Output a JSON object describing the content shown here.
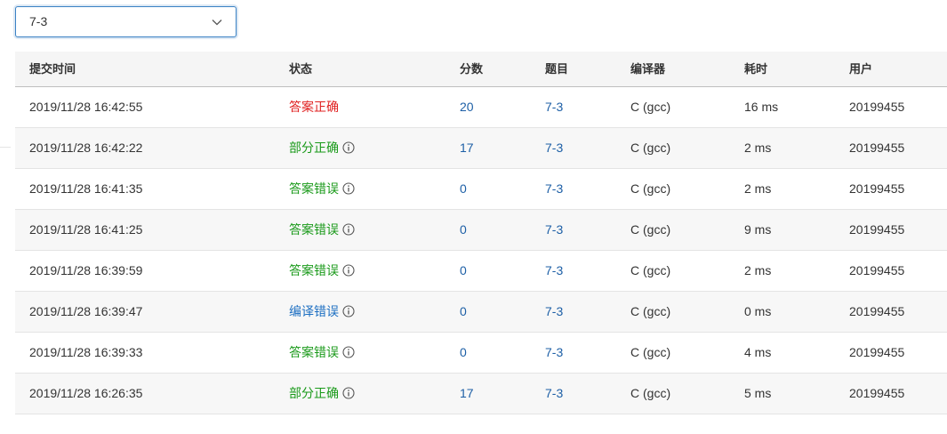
{
  "filter": {
    "selected": "7-3"
  },
  "columns": {
    "time": "提交时间",
    "status": "状态",
    "score": "分数",
    "problem": "题目",
    "compiler": "编译器",
    "duration": "耗时",
    "user": "用户"
  },
  "colors": {
    "correct": "#e02020",
    "partial": "#1a9a1a",
    "wrong": "#1a9a1a",
    "compile_error": "#1d6fc2",
    "link": "#1d5fa6"
  },
  "rows": [
    {
      "time": "2019/11/28 16:42:55",
      "status": "答案正确",
      "status_type": "correct",
      "score": "20",
      "problem": "7-3",
      "compiler": "C (gcc)",
      "duration": "16 ms",
      "user": "20199455",
      "info": false
    },
    {
      "time": "2019/11/28 16:42:22",
      "status": "部分正确",
      "status_type": "partial",
      "score": "17",
      "problem": "7-3",
      "compiler": "C (gcc)",
      "duration": "2 ms",
      "user": "20199455",
      "info": true
    },
    {
      "time": "2019/11/28 16:41:35",
      "status": "答案错误",
      "status_type": "wrong",
      "score": "0",
      "problem": "7-3",
      "compiler": "C (gcc)",
      "duration": "2 ms",
      "user": "20199455",
      "info": true
    },
    {
      "time": "2019/11/28 16:41:25",
      "status": "答案错误",
      "status_type": "wrong",
      "score": "0",
      "problem": "7-3",
      "compiler": "C (gcc)",
      "duration": "9 ms",
      "user": "20199455",
      "info": true
    },
    {
      "time": "2019/11/28 16:39:59",
      "status": "答案错误",
      "status_type": "wrong",
      "score": "0",
      "problem": "7-3",
      "compiler": "C (gcc)",
      "duration": "2 ms",
      "user": "20199455",
      "info": true
    },
    {
      "time": "2019/11/28 16:39:47",
      "status": "编译错误",
      "status_type": "compile_error",
      "score": "0",
      "problem": "7-3",
      "compiler": "C (gcc)",
      "duration": "0 ms",
      "user": "20199455",
      "info": true
    },
    {
      "time": "2019/11/28 16:39:33",
      "status": "答案错误",
      "status_type": "wrong",
      "score": "0",
      "problem": "7-3",
      "compiler": "C (gcc)",
      "duration": "4 ms",
      "user": "20199455",
      "info": true
    },
    {
      "time": "2019/11/28 16:26:35",
      "status": "部分正确",
      "status_type": "partial",
      "score": "17",
      "problem": "7-3",
      "compiler": "C (gcc)",
      "duration": "5 ms",
      "user": "20199455",
      "info": true
    }
  ]
}
